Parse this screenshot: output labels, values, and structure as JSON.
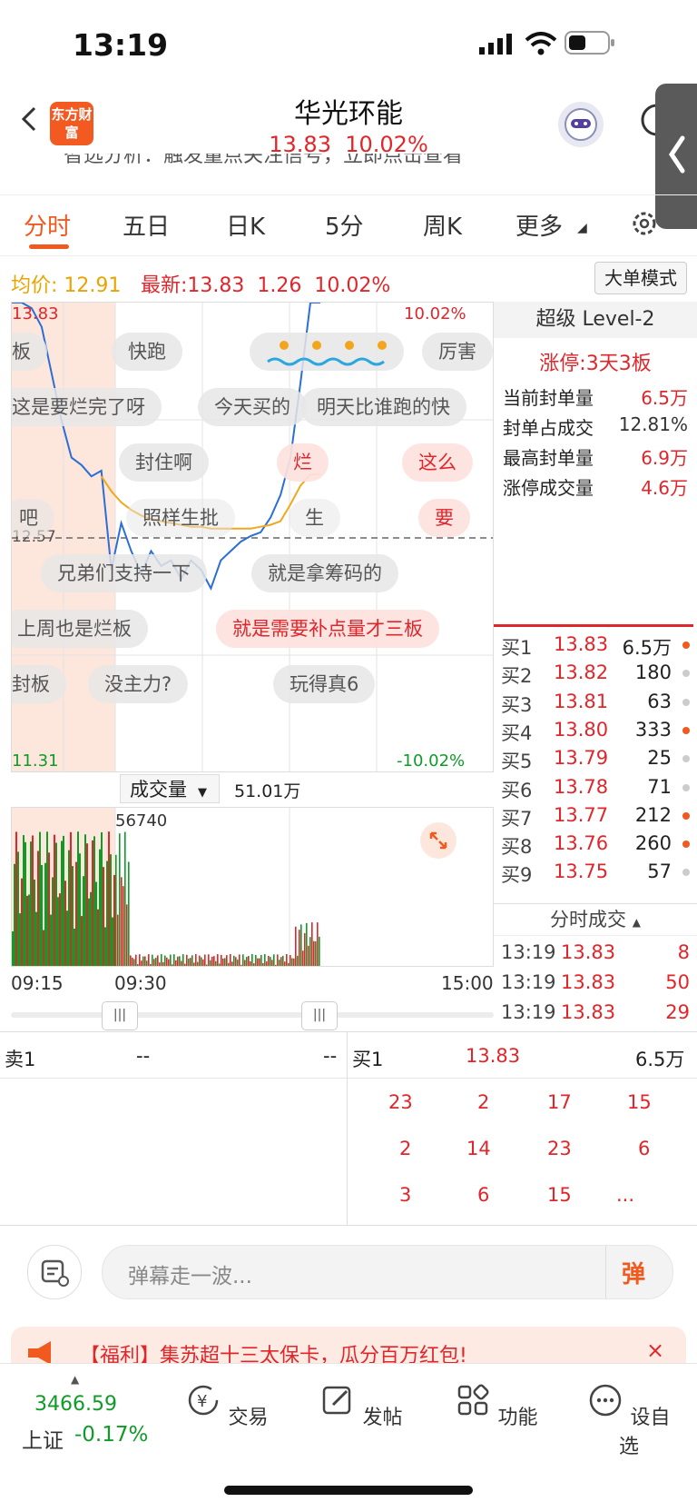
{
  "status_bar": {
    "time": "13:19"
  },
  "header": {
    "logo_text": "东方财富",
    "stock_name": "华光环能",
    "price": "13.83",
    "change_pct": "10.02%",
    "notice_partial": "智选分析：触发量点关注信号，立即点击查看"
  },
  "tabs": [
    "分时",
    "五日",
    "日K",
    "5分",
    "周K",
    "更多"
  ],
  "info_row": {
    "avg_label": "均价:",
    "avg_value": "12.91",
    "latest_label": "最新:",
    "latest_value": "13.83",
    "change": "1.26",
    "change_pct": "10.02%",
    "mode_button": "大单模式"
  },
  "chart": {
    "top_left": "13.83",
    "top_right": "10.02%",
    "bottom_left": "11.31",
    "bottom_right": "-10.02%",
    "mid_label": "12.57"
  },
  "chart_data": {
    "type": "line",
    "ylim": [
      11.31,
      13.83
    ],
    "reference": 12.57,
    "series": [
      {
        "name": "",
        "values": [
          13.83,
          13.83,
          13.8,
          13.7,
          13.45,
          13.2,
          13.0,
          12.96,
          12.9,
          12.93,
          12.4,
          12.65,
          12.5,
          12.38,
          12.5,
          12.42,
          12.45,
          12.35,
          12.45,
          12.4,
          12.3,
          12.45,
          12.5,
          12.55,
          12.58,
          12.6,
          12.68,
          12.8,
          13.0,
          13.4,
          13.83,
          13.83
        ]
      },
      {
        "name": "",
        "values": [
          null,
          null,
          null,
          null,
          null,
          null,
          null,
          null,
          null,
          12.9,
          12.82,
          12.76,
          12.72,
          12.69,
          12.67,
          12.66,
          12.65,
          12.64,
          12.63,
          12.63,
          12.62,
          12.62,
          12.62,
          12.62,
          12.62,
          12.63,
          12.64,
          12.66,
          12.75,
          12.85,
          12.91,
          12.91
        ]
      }
    ]
  },
  "danmu": [
    "板",
    "快跑",
    "厉害",
    "这是要烂完了呀",
    "今天买的",
    "明天比谁跑的快",
    "封住啊",
    "烂",
    "这么",
    "吧",
    "照样生批",
    "生",
    "要",
    "兄弟们支持一下",
    "就是拿筹码的",
    "上周也是烂板",
    "就是需要补点量才三板",
    "封板",
    "没主力?",
    "玩得真6"
  ],
  "level2": {
    "title": "超级 Level-2",
    "limit_label": "涨停:",
    "limit_value": "3天3板",
    "stats": [
      {
        "label": "当前封单量",
        "value": "6.5万"
      },
      {
        "label": "封单占成交",
        "value": "12.81%"
      },
      {
        "label": "最高封单量",
        "value": "6.9万"
      },
      {
        "label": "涨停成交量",
        "value": "4.6万"
      }
    ],
    "bids": [
      {
        "label": "买1",
        "price": "13.83",
        "vol": "6.5万",
        "dot": "#f05a1e"
      },
      {
        "label": "买2",
        "price": "13.82",
        "vol": "180",
        "dot": "#cccccc"
      },
      {
        "label": "买3",
        "price": "13.81",
        "vol": "63",
        "dot": "#cccccc"
      },
      {
        "label": "买4",
        "price": "13.80",
        "vol": "333",
        "dot": "#f05a1e"
      },
      {
        "label": "买5",
        "price": "13.79",
        "vol": "25",
        "dot": "#cccccc"
      },
      {
        "label": "买6",
        "price": "13.78",
        "vol": "71",
        "dot": "#cccccc"
      },
      {
        "label": "买7",
        "price": "13.77",
        "vol": "212",
        "dot": "#f05a1e"
      },
      {
        "label": "买8",
        "price": "13.76",
        "vol": "260",
        "dot": "#f05a1e"
      },
      {
        "label": "买9",
        "price": "13.75",
        "vol": "57",
        "dot": "#cccccc"
      }
    ],
    "ticks_title": "分时成交",
    "ticks": [
      {
        "time": "13:19",
        "price": "13.83",
        "vol": "8"
      },
      {
        "time": "13:19",
        "price": "13.83",
        "vol": "50"
      },
      {
        "time": "13:19",
        "price": "13.83",
        "vol": "29"
      }
    ]
  },
  "volume": {
    "label": "成交量",
    "total": "51.01万",
    "max": "56740",
    "times": [
      "09:15",
      "09:30",
      "15:00"
    ]
  },
  "queue": {
    "sell_label": "卖1",
    "sell_price": "--",
    "sell_vol": "--",
    "buy_label": "买1",
    "buy_price": "13.83",
    "buy_vol": "6.5万",
    "rows": [
      [
        "23",
        "2",
        "17",
        "15"
      ],
      [
        "2",
        "14",
        "23",
        "6"
      ],
      [
        "3",
        "6",
        "15",
        "..."
      ]
    ]
  },
  "danmu_input": {
    "placeholder": "弹幕走一波...",
    "send_label": "弹"
  },
  "banner": {
    "text": "【福利】集苏超十三太保卡，瓜分百万红包!"
  },
  "bottom_nav": {
    "index_value": "3466.59",
    "index_name": "上证",
    "index_change": "-0.17%",
    "items": [
      "交易",
      "发帖",
      "功能",
      "设自选"
    ]
  }
}
